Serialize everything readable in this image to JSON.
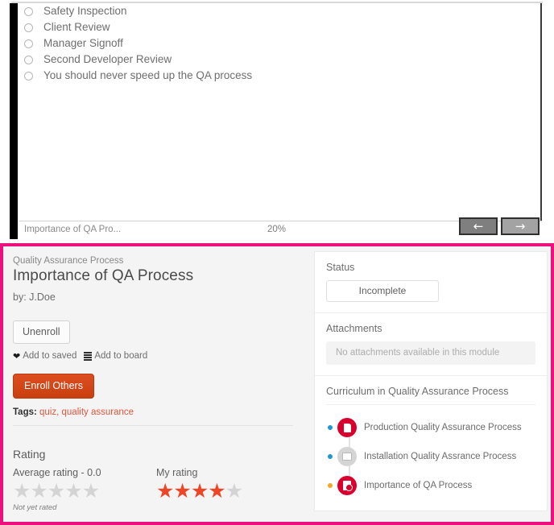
{
  "quiz": {
    "options": [
      {
        "label": "Safety Inspection",
        "selected": false
      },
      {
        "label": "Client Review",
        "selected": false
      },
      {
        "label": "Manager Signoff",
        "selected": false
      },
      {
        "label": "Second Developer Review",
        "selected": false
      },
      {
        "label": "You should never speed up the QA process",
        "selected": false
      }
    ],
    "footer": {
      "module_name": "Importance of QA Pro...",
      "progress": "20%",
      "prev_icon": "arrow-left-icon",
      "next_icon": "arrow-right-icon",
      "prev_glyph": "←",
      "next_glyph": "→"
    }
  },
  "detail": {
    "breadcrumb": "Quality Assurance Process",
    "title": "Importance of QA Process",
    "author": "by: J.Doe",
    "unenroll_label": "Unenroll",
    "add_to_saved_label": "Add to saved",
    "add_to_board_label": "Add to board",
    "saved_icon": "heart-icon",
    "board_icon": "list-icon",
    "enroll_others_label": "Enroll Others",
    "tags_label": "Tags:",
    "tags_values": "quiz, quality assurance",
    "rating": {
      "heading": "Rating",
      "average_caption": "Average rating - 0.0",
      "average_value": 0.0,
      "average_stars_filled": 0,
      "my_caption": "My rating",
      "my_value": 4,
      "my_stars_filled": 4,
      "stars_total": 5,
      "star_glyph": "★",
      "not_yet_rated": "Not yet rated"
    }
  },
  "sidebar": {
    "status": {
      "heading": "Status",
      "value": "Incomplete"
    },
    "attachments": {
      "heading": "Attachments",
      "empty_message": "No attachments available in this module"
    },
    "curriculum": {
      "heading": "Curriculum in Quality Assurance Process",
      "items": [
        {
          "label": "Production Quality Assurance Process",
          "icon": "document-icon",
          "icon_style": "red",
          "glyph": "doc",
          "dot_color": "#2196d8"
        },
        {
          "label": "Installation Quality Assrance Process",
          "icon": "slide-icon",
          "icon_style": "gray",
          "glyph": "slide",
          "dot_color": "#2196d8"
        },
        {
          "label": "Importance of QA Process",
          "icon": "quiz-icon",
          "icon_style": "red",
          "glyph": "quiz",
          "dot_color": "#f5a623"
        }
      ]
    }
  },
  "colors": {
    "highlight_border": "#ec0f7e",
    "accent_red": "#d9002e",
    "enroll_button": "#c8400e",
    "star_filled": "#ee4526",
    "star_empty": "#d4d4d4",
    "panel_background": "#f4f4f4"
  }
}
